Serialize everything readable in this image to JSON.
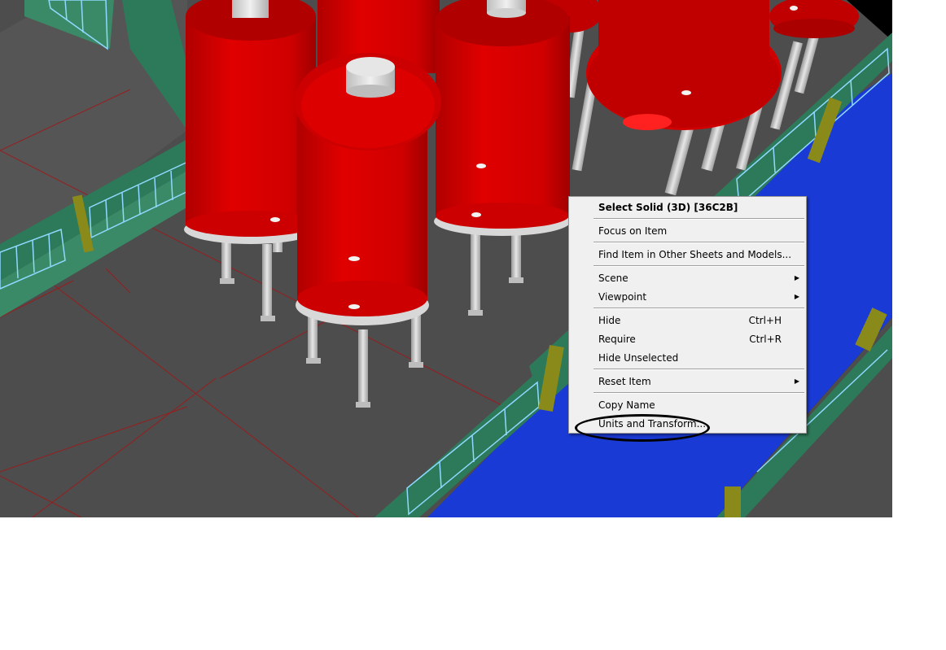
{
  "viewport": {
    "description_icon": "3d-scene",
    "colors": {
      "floor": "#4a4a4a",
      "tank": "#cc0000",
      "water": "#1a3ad6",
      "wall": "#2d7a5a",
      "background": "#000000"
    }
  },
  "context_menu": {
    "items": [
      {
        "label": "Select Solid (3D) [36C2B]",
        "shortcut": "",
        "submenu": false,
        "bold": true
      },
      {
        "label": "Focus on Item",
        "shortcut": "",
        "submenu": false
      },
      {
        "label": "Find Item in Other Sheets and Models...",
        "shortcut": "",
        "submenu": false
      },
      {
        "label": "Scene",
        "shortcut": "",
        "submenu": true
      },
      {
        "label": "Viewpoint",
        "shortcut": "",
        "submenu": true
      },
      {
        "label": "Hide",
        "shortcut": "Ctrl+H",
        "submenu": false
      },
      {
        "label": "Require",
        "shortcut": "Ctrl+R",
        "submenu": false
      },
      {
        "label": "Hide Unselected",
        "shortcut": "",
        "submenu": false
      },
      {
        "label": "Reset Item",
        "shortcut": "",
        "submenu": true
      },
      {
        "label": "Copy Name",
        "shortcut": "",
        "submenu": false
      },
      {
        "label": "Units and Transform...",
        "shortcut": "",
        "submenu": false
      }
    ],
    "submenu_arrow": "▶"
  }
}
